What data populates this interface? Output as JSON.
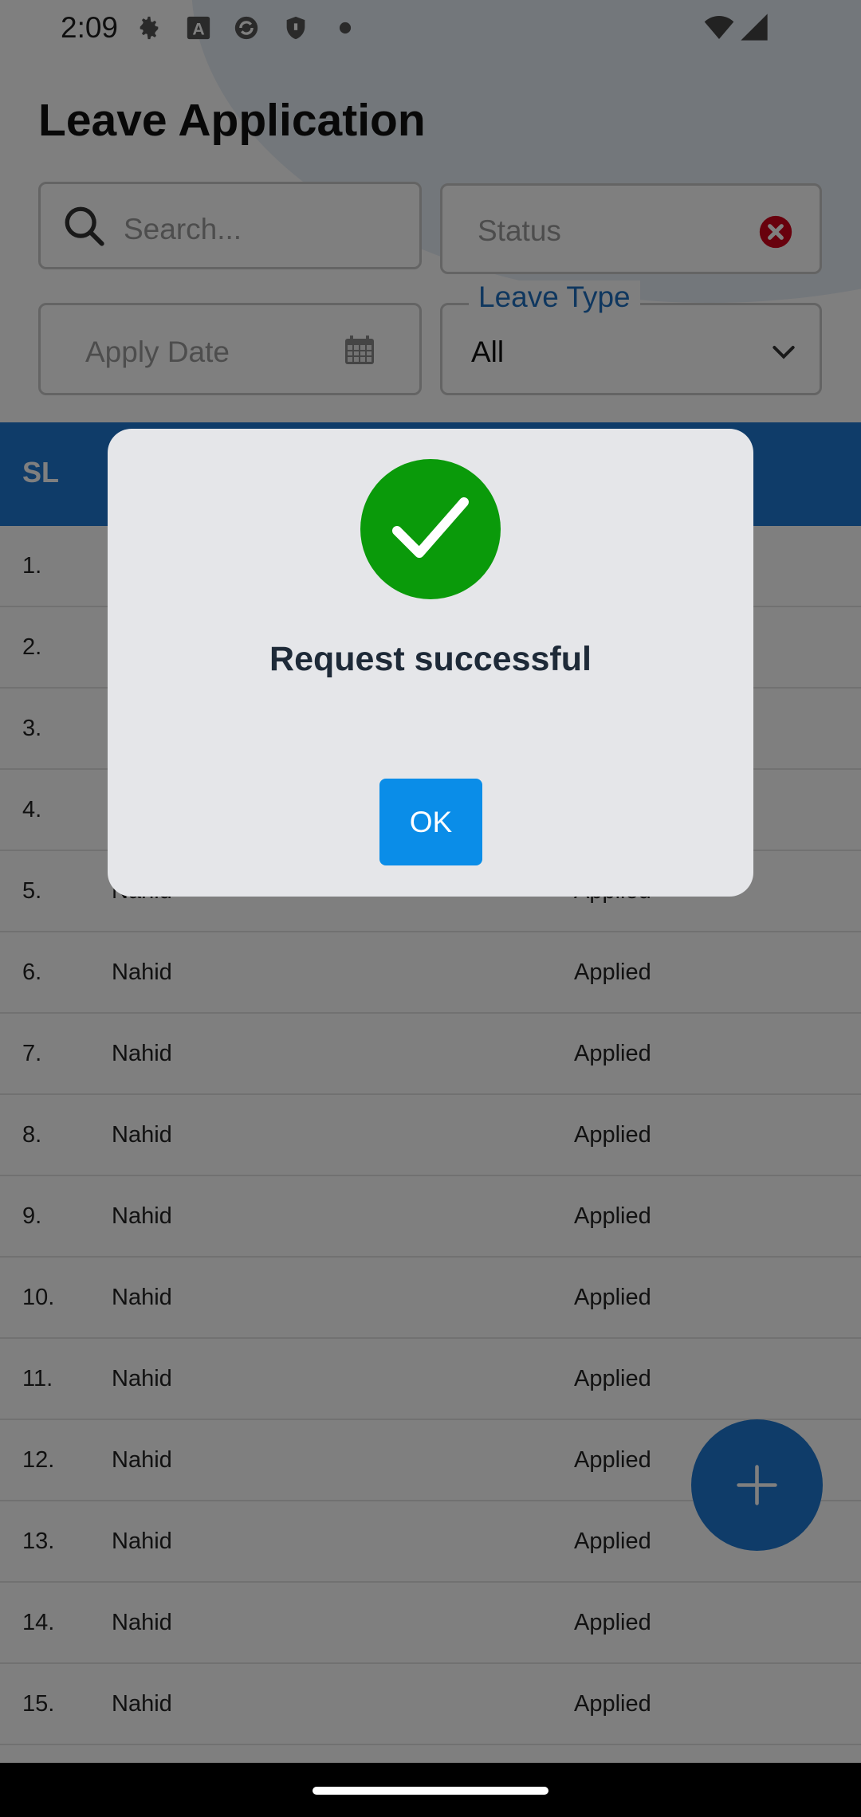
{
  "status_bar": {
    "time": "2:09",
    "icons": [
      "gear-icon",
      "font-a-icon",
      "sync-circle-icon",
      "shield-icon",
      "dot-icon",
      "wifi-icon",
      "signal-icon"
    ]
  },
  "page": {
    "title": "Leave Application"
  },
  "filters": {
    "search_placeholder": "Search...",
    "status_placeholder": "Status",
    "apply_date_placeholder": "Apply Date",
    "leave_type_label": "Leave Type",
    "leave_type_value": "All"
  },
  "table": {
    "header_sl": "SL",
    "rows": [
      {
        "sl": "1.",
        "name": "",
        "status": ""
      },
      {
        "sl": "2.",
        "name": "",
        "status": ""
      },
      {
        "sl": "3.",
        "name": "",
        "status": ""
      },
      {
        "sl": "4.",
        "name": "",
        "status": ""
      },
      {
        "sl": "5.",
        "name": "Nahid",
        "status": "Applied"
      },
      {
        "sl": "6.",
        "name": "Nahid",
        "status": "Applied"
      },
      {
        "sl": "7.",
        "name": "Nahid",
        "status": "Applied"
      },
      {
        "sl": "8.",
        "name": "Nahid",
        "status": "Applied"
      },
      {
        "sl": "9.",
        "name": "Nahid",
        "status": "Applied"
      },
      {
        "sl": "10.",
        "name": "Nahid",
        "status": "Applied"
      },
      {
        "sl": "11.",
        "name": "Nahid",
        "status": "Applied"
      },
      {
        "sl": "12.",
        "name": "Nahid",
        "status": "Applied"
      },
      {
        "sl": "13.",
        "name": "Nahid",
        "status": "Applied"
      },
      {
        "sl": "14.",
        "name": "Nahid",
        "status": "Applied"
      },
      {
        "sl": "15.",
        "name": "Nahid",
        "status": "Applied"
      }
    ]
  },
  "dialog": {
    "message": "Request successful",
    "ok_label": "OK"
  },
  "colors": {
    "accent": "#1e78d2",
    "success": "#0a9a0a",
    "ok_button": "#0a8de8",
    "clear_icon": "#d0021b"
  }
}
